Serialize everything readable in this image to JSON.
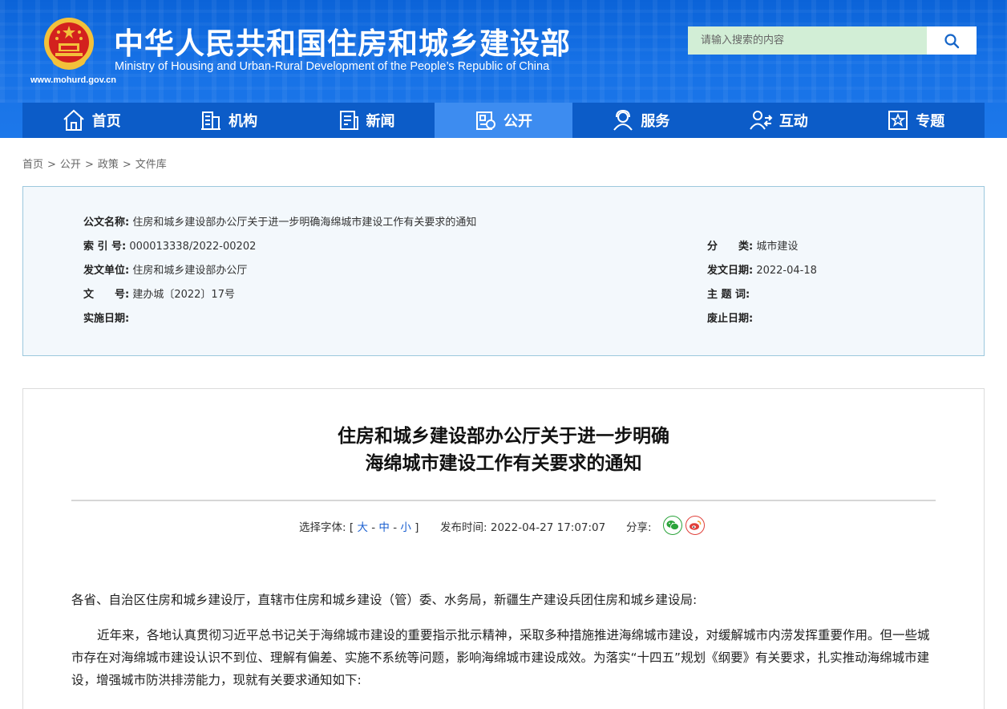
{
  "header": {
    "title_cn": "中华人民共和国住房和城乡建设部",
    "title_en": "Ministry of Housing and Urban-Rural Development of the People’s Republic of China",
    "site_url": "www.mohurd.gov.cn",
    "search_placeholder": "请输入搜索的内容"
  },
  "nav": {
    "items": [
      {
        "label": "首页",
        "icon": "home-icon"
      },
      {
        "label": "机构",
        "icon": "building-icon"
      },
      {
        "label": "新闻",
        "icon": "news-icon"
      },
      {
        "label": "公开",
        "icon": "disclosure-icon",
        "active": true
      },
      {
        "label": "服务",
        "icon": "service-icon"
      },
      {
        "label": "互动",
        "icon": "interaction-icon"
      },
      {
        "label": "专题",
        "icon": "topic-icon"
      }
    ]
  },
  "breadcrumb": {
    "items": [
      "首页",
      "公开",
      "政策",
      "文件库"
    ],
    "separator": ">"
  },
  "info": {
    "doc_name_key": "公文名称:",
    "doc_name": "住房和城乡建设部办公厅关于进一步明确海绵城市建设工作有关要求的通知",
    "index_no_key": "索 引 号:",
    "index_no": "000013338/2022-00202",
    "category_key": "分　　类:",
    "category": "城市建设",
    "issuer_key": "发文单位:",
    "issuer": "住房和城乡建设部办公厅",
    "issue_date_key": "发文日期:",
    "issue_date": "2022-04-18",
    "doc_no_key": "文　　号:",
    "doc_no": "建办城〔2022〕17号",
    "subject_key": "主 题 词:",
    "subject": "",
    "effective_date_key": "实施日期:",
    "effective_date": "",
    "expiry_date_key": "废止日期:",
    "expiry_date": ""
  },
  "article": {
    "title_line1": "住房和城乡建设部办公厅关于进一步明确",
    "title_line2": "海绵城市建设工作有关要求的通知",
    "font_size_label": "选择字体:",
    "font_bracket_open": "[",
    "font_large": "大",
    "font_medium": "中",
    "font_small": "小",
    "font_dash": "-",
    "font_bracket_close": "]",
    "publish_label": "发布时间:",
    "publish_time": "2022-04-27 17:07:07",
    "share_label": "分享:",
    "salutation": "各省、自治区住房和城乡建设厅，直辖市住房和城乡建设（管）委、水务局，新疆生产建设兵团住房和城乡建设局:",
    "para1": "近年来，各地认真贯彻习近平总书记关于海绵城市建设的重要指示批示精神，采取多种措施推进海绵城市建设，对缓解城市内涝发挥重要作用。但一些城市存在对海绵城市建设认识不到位、理解有偏差、实施不系统等问题，影响海绵城市建设成效。为落实“十四五”规划《纲要》有关要求，扎实推动海绵城市建设，增强城市防洪排涝能力，现就有关要求通知如下:"
  },
  "colors": {
    "header_blue": "#1671e6",
    "nav_dark": "#0c5cc8",
    "nav_active": "#3d8cf0",
    "link_blue": "#1a5fd0"
  }
}
